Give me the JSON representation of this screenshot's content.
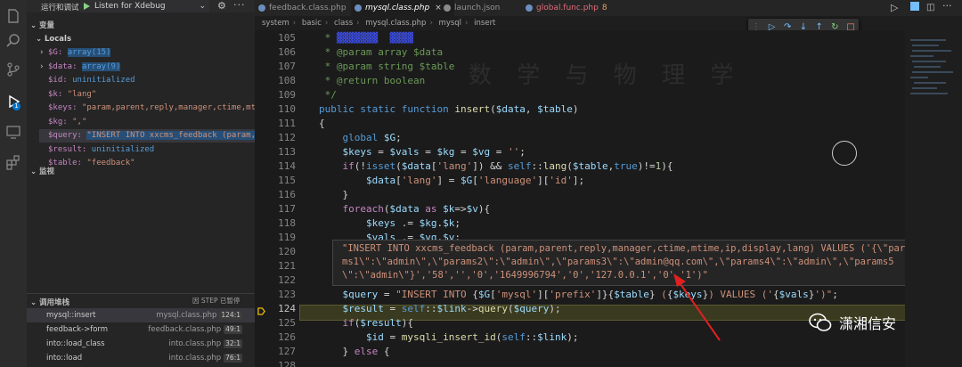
{
  "sidebar": {
    "header": {
      "title": "运行和调试",
      "launch_config": "Listen for Xdebug"
    },
    "variables_title": "变量",
    "locals_title": "Locals",
    "locals": [
      {
        "name": "$G:",
        "value": "array(15)",
        "expandable": true
      },
      {
        "name": "$data:",
        "value": "array(9)",
        "expandable": true
      },
      {
        "name": "$id:",
        "value": "uninitialized",
        "expandable": false
      },
      {
        "name": "$k:",
        "value": "\"lang\"",
        "expandable": false
      },
      {
        "name": "$keys:",
        "value": "\"param,parent,reply,manager,ctime,mt…",
        "expandable": false
      },
      {
        "name": "$kg:",
        "value": "\",\"",
        "expandable": false
      },
      {
        "name": "$query:",
        "value": "\"INSERT INTO xxcms_feedback (param,…",
        "expandable": false
      },
      {
        "name": "$result:",
        "value": "uninitialized",
        "expandable": false
      },
      {
        "name": "$table:",
        "value": "\"feedback\"",
        "expandable": false
      }
    ],
    "watch_title": "监视",
    "callstack_title": "调用堆栈",
    "callstack_status": "因 STEP 已暂停",
    "callstack": [
      {
        "fn": "mysql::insert",
        "file": "mysql.class.php",
        "line": "124:1"
      },
      {
        "fn": "feedback->form",
        "file": "feedback.class.php",
        "line": "49:1"
      },
      {
        "fn": "into::load_class",
        "file": "into.class.php",
        "line": "32:1"
      },
      {
        "fn": "into::load",
        "file": "into.class.php",
        "line": "76:1"
      }
    ]
  },
  "tabs": [
    {
      "label": "feedback.class.php",
      "active": false,
      "modified": ""
    },
    {
      "label": "mysql.class.php",
      "active": true,
      "modified": ""
    },
    {
      "label": "launch.json",
      "active": false,
      "modified": ""
    },
    {
      "label": "global.func.php",
      "active": false,
      "modified": "8"
    }
  ],
  "breadcrumb": [
    "system",
    "basic",
    "class",
    "mysql.class.php",
    "mysql",
    "insert"
  ],
  "editor": {
    "line_numbers": [
      "105",
      "106",
      "107",
      "108",
      "109",
      "110",
      "111",
      "112",
      "113",
      "114",
      "115",
      "116",
      "117",
      "118",
      "119",
      "120",
      "121",
      "122",
      "123",
      "124",
      "125",
      "126",
      "127",
      "128"
    ],
    "current_line": "124",
    "hover_lines": [
      "\"INSERT INTO xxcms_feedback (param,parent,reply,manager,ctime,mtime,ip,display,lang) VALUES ('{\\\"para",
      "ms1\\\":\\\"admin\\\",\\\"params2\\\":\\\"admin\\\",\\\"params3\\\":\\\"admin@qq.com\\\",\\\"params4\\\":\\\"admin\\\",\\\"params5",
      "\\\":\\\"admin\\\"}','58','','0','1649996794','0','127.0.0.1','0','1')\""
    ]
  },
  "background_text": "数 学 与 物 理 学",
  "watermark": "潇湘信安",
  "colors": {
    "accent": "#0078d4",
    "current_line": "#3a3a20",
    "arrow": "#e02020"
  }
}
